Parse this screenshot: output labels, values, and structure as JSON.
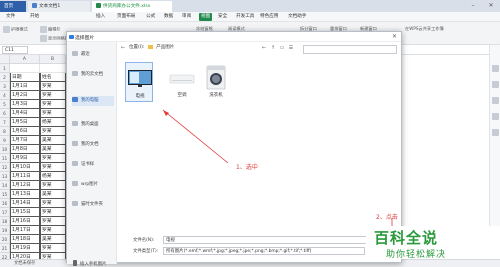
{
  "titlebar": {
    "tabs": [
      {
        "label": "首页"
      },
      {
        "label": "文本文档1"
      },
      {
        "label": "供货商库办公文件.xlsx"
      }
    ]
  },
  "menubar": {
    "items": [
      "文件",
      "开始",
      "插入",
      "页面布局",
      "公式",
      "数据",
      "审阅",
      "视图",
      "安全",
      "开发工具",
      "特色应用",
      "文档助手"
    ],
    "selected_index": 7
  },
  "ribbon": {
    "labels": [
      "护眼模式",
      "编辑栏",
      "显示网格线",
      "冻结窗格",
      "阅读模式",
      "拆分窗口",
      "重排窗口",
      "新建窗口"
    ],
    "right_label": "在WPS云共享工作簿"
  },
  "formula_bar": {
    "cell_ref": "C11"
  },
  "sheet": {
    "col_headers": [
      "A",
      "B"
    ],
    "rows": [
      {
        "n": "1",
        "a": "",
        "b": ""
      },
      {
        "n": "2",
        "a": "日期",
        "b": "姓名"
      },
      {
        "n": "3",
        "a": "1月1日",
        "b": "罗某"
      },
      {
        "n": "4",
        "a": "1月2日",
        "b": "罗某"
      },
      {
        "n": "5",
        "a": "1月3日",
        "b": "罗某"
      },
      {
        "n": "6",
        "a": "1月4日",
        "b": "罗某"
      },
      {
        "n": "7",
        "a": "1月5日",
        "b": "杨某"
      },
      {
        "n": "8",
        "a": "1月6日",
        "b": "罗某"
      },
      {
        "n": "9",
        "a": "1月7日",
        "b": "吴某"
      },
      {
        "n": "10",
        "a": "1月8日",
        "b": "吴某"
      },
      {
        "n": "11",
        "a": "1月9日",
        "b": "罗某"
      },
      {
        "n": "12",
        "a": "1月10日",
        "b": "罗某"
      },
      {
        "n": "13",
        "a": "1月11日",
        "b": "杨某"
      },
      {
        "n": "14",
        "a": "1月12日",
        "b": "罗某"
      },
      {
        "n": "15",
        "a": "1月13日",
        "b": "吴某"
      },
      {
        "n": "16",
        "a": "1月14日",
        "b": "罗某"
      },
      {
        "n": "17",
        "a": "1月15日",
        "b": "罗某"
      },
      {
        "n": "18",
        "a": "1月16日",
        "b": "罗某"
      },
      {
        "n": "19",
        "a": "1月17日",
        "b": "罗某"
      },
      {
        "n": "20",
        "a": "1月18日",
        "b": "吴某"
      },
      {
        "n": "21",
        "a": "1月19日",
        "b": "罗某"
      },
      {
        "n": "22",
        "a": "1月20日",
        "b": "罗某"
      }
    ]
  },
  "statusbar": {
    "text": "文档未保存"
  },
  "dialog": {
    "title": "选择图片",
    "sidebar": [
      {
        "label": "最近"
      },
      {
        "label": "我的云文档"
      },
      {
        "label": "我的电脑"
      },
      {
        "label": "我的桌面"
      },
      {
        "label": "我的文档"
      },
      {
        "label": "证书样"
      },
      {
        "label": "wrp图片"
      },
      {
        "label": "猫时文件夹"
      }
    ],
    "sidebar_selected": 2,
    "location_label": "位置(I):",
    "location_value": "产品图片",
    "thumbnails": [
      {
        "label": "电视"
      },
      {
        "label": "空调"
      },
      {
        "label": "洗衣机"
      }
    ],
    "selected_thumb": 0,
    "phone_link": "插入手机图片",
    "filename_label": "文件名(N):",
    "filename_value": "电视",
    "filetype_label": "文件类型(T):",
    "filetype_value": "所有图片(*.emf;*.wmf;*.jpg;*.jpeg;*.jpe;*.png;*.bmp;*.gif;*.tif;*.tiff)"
  },
  "annotations": {
    "step1": "1、选中",
    "step2": "2、点击"
  },
  "watermark": {
    "big": "百科全说",
    "small": "助你轻松解决"
  }
}
